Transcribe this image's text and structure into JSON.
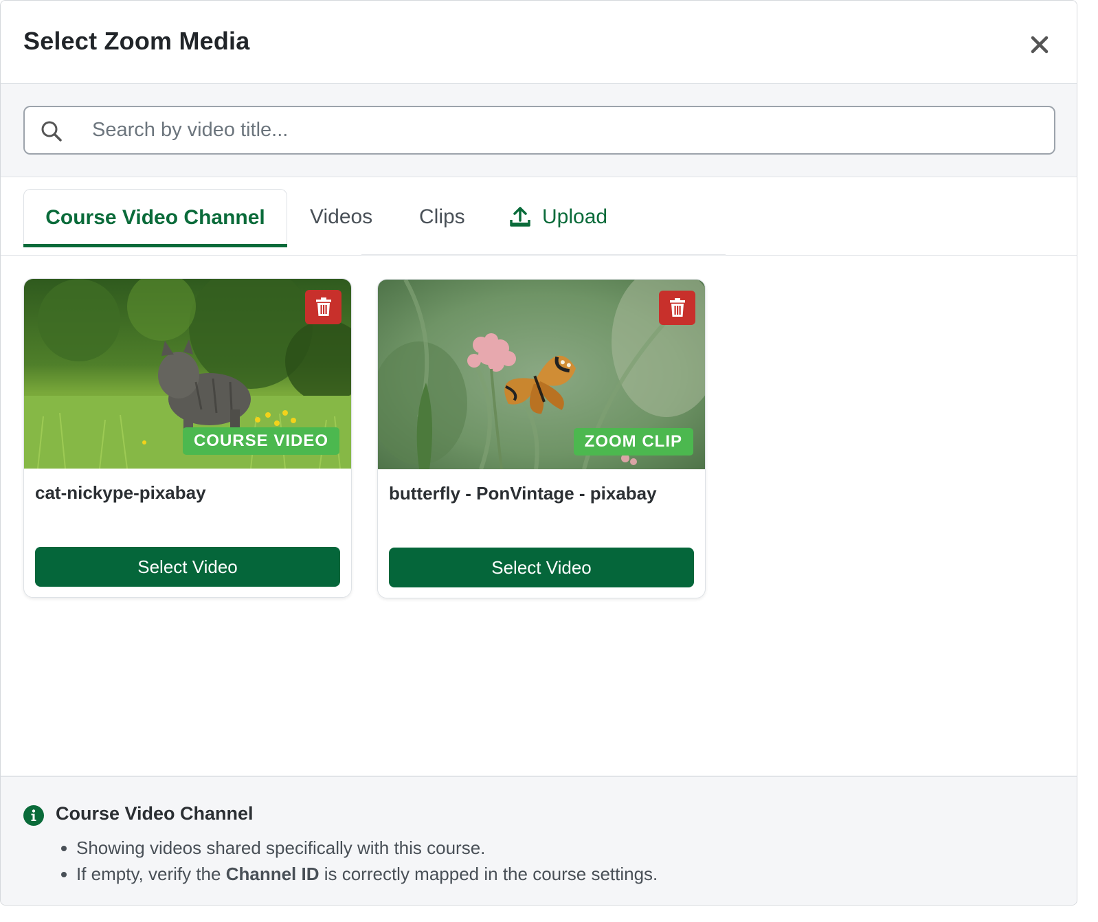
{
  "modal": {
    "title": "Select Zoom Media"
  },
  "search": {
    "placeholder": "Search by video title..."
  },
  "tabs": [
    {
      "label": "Course Video Channel",
      "active": true
    },
    {
      "label": "Videos",
      "active": false
    },
    {
      "label": "Clips",
      "active": false
    },
    {
      "label": "Upload",
      "active": false,
      "icon": "upload-icon"
    }
  ],
  "cards": [
    {
      "title": "cat-nickype-pixabay",
      "badge": "COURSE VIDEO",
      "button": "Select Video",
      "thumb": "cat-in-grass"
    },
    {
      "title": "butterfly - PonVintage - pixabay",
      "badge": "ZOOM CLIP",
      "button": "Select Video",
      "thumb": "butterfly-on-flower"
    }
  ],
  "info": {
    "title": "Course Video Channel",
    "line1": "Showing videos shared specifically with this course.",
    "line2_pre": "If empty, verify the ",
    "line2_bold": "Channel ID",
    "line2_post": " is correctly mapped in the course settings."
  },
  "colors": {
    "brand_green": "#0a6b3a",
    "button_green": "#05663a",
    "badge_green": "#4cb84f",
    "delete_red": "#c8302b"
  }
}
